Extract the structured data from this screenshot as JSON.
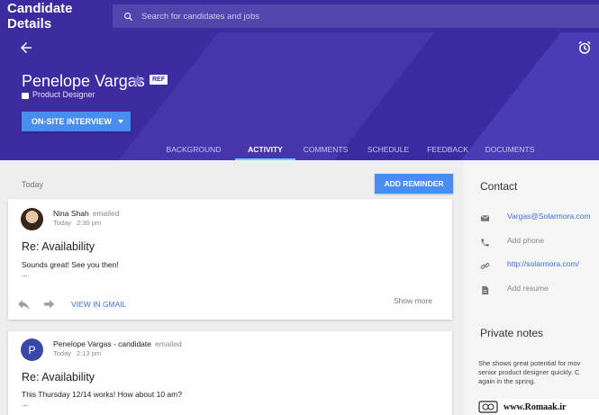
{
  "app": {
    "title": "Candidate Details"
  },
  "search": {
    "placeholder": "Search for candidates and jobs"
  },
  "candidate": {
    "name": "Penelope Vargas",
    "badge": "REF",
    "role": "Product Designer"
  },
  "stage_button": {
    "label": "ON-SITE INTERVIEW"
  },
  "tabs": [
    {
      "label": "BACKGROUND",
      "active": false
    },
    {
      "label": "ACTIVITY",
      "active": true
    },
    {
      "label": "COMMENTS",
      "active": false
    },
    {
      "label": "SCHEDULE",
      "active": false
    },
    {
      "label": "FEEDBACK",
      "active": false
    },
    {
      "label": "DOCUMENTS",
      "active": false
    }
  ],
  "activity": {
    "date_label": "Today",
    "reminder_label": "ADD REMINDER",
    "items": [
      {
        "sender": "Nina Shah",
        "action": "emailed",
        "day": "Today",
        "time": "2:30 pm",
        "subject": "Re: Availability",
        "snippet": "Sounds great! See you then!",
        "ellipsis": "...",
        "view_label": "VIEW IN GMAIL",
        "more_label": "Show more"
      },
      {
        "avatar_letter": "P",
        "sender": "Penelope Vargas - candidate",
        "action": "emailed",
        "day": "Today",
        "time": "2:13 pm",
        "subject": "Re: Availability",
        "snippet": "This Thursday 12/14 works! How about 10 am?",
        "ellipsis": "..."
      }
    ]
  },
  "contact": {
    "title": "Contact",
    "email": "Vargas@Solarmora.com",
    "phone_placeholder": "Add phone",
    "website": "http://solarmora.com/",
    "resume_placeholder": "Add resume"
  },
  "notes": {
    "title": "Private notes",
    "lines": [
      "She shows great potential for mov",
      "senior product designer quickly. C",
      "again in the spring."
    ]
  },
  "watermark": {
    "text": "www.Romaak.ir"
  },
  "colors": {
    "brand": "#3a2c9e",
    "accent_button": "#4a8df0",
    "tab_indicator": "#5fd3f8",
    "link": "#3f6fd8"
  },
  "icons": {
    "search": "search-icon",
    "back": "arrow-back-icon",
    "alarm": "alarm-icon",
    "star": "star-icon",
    "reply": "reply-icon",
    "forward": "forward-icon",
    "email": "email-icon",
    "phone": "phone-icon",
    "link": "link-icon",
    "document": "document-icon"
  }
}
